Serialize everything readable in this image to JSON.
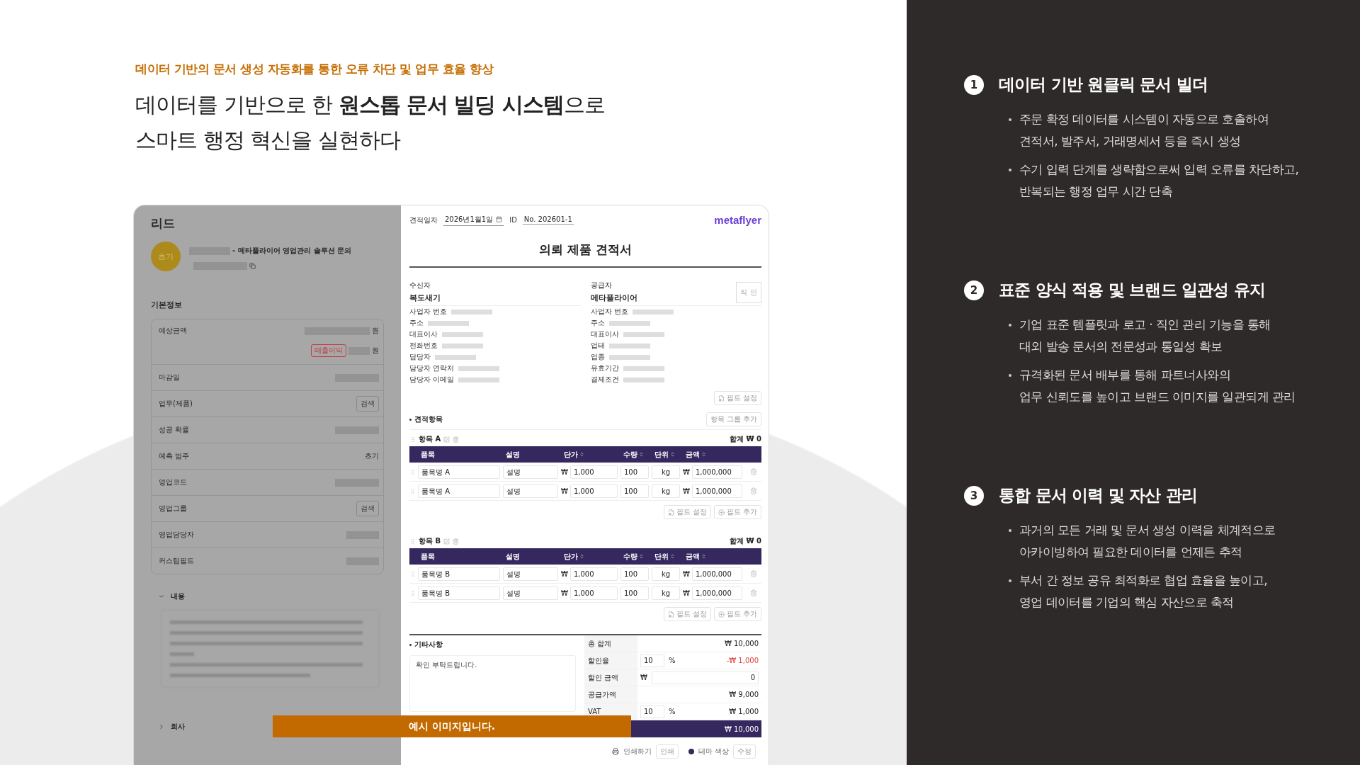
{
  "header": {
    "eyebrow": "데이터 기반의 문서 생성 자동화를 통한 오류 차단 및 업무 효율 향상",
    "headline": [
      "데이터를 기반으로 한 **원스톱 문서 빌딩 시스템**으로",
      "스마트 행정 혁신을 실현하다"
    ]
  },
  "lead_panel": {
    "title": "리드",
    "status_badge": "초기",
    "lead_name": "- 메타플라이어 영업관리 솔루션 문의",
    "section_title": "기본정보",
    "fields": [
      {
        "label": "예상금액",
        "kind": "amount",
        "unit": "원",
        "tag": "매출이익",
        "tag_unit": "원"
      },
      {
        "label": "마감일",
        "kind": "redacted"
      },
      {
        "label": "업무(제품)",
        "kind": "button",
        "button": "검색"
      },
      {
        "label": "성공 확률",
        "kind": "redacted"
      },
      {
        "label": "예측 범주",
        "kind": "text",
        "value": "초기"
      },
      {
        "label": "영업코드",
        "kind": "redacted"
      },
      {
        "label": "영업그룹",
        "kind": "button",
        "button": "검색"
      },
      {
        "label": "영업담당자",
        "kind": "redacted_short"
      },
      {
        "label": "커스텀필드",
        "kind": "redacted_short"
      }
    ],
    "sections": [
      {
        "title": "내용",
        "expanded": true
      },
      {
        "title": "회사",
        "expanded": false
      }
    ]
  },
  "quote": {
    "date_label": "견적일자",
    "date": "2026년1월1일",
    "id_label": "ID",
    "id_value": "No. 202601-1",
    "logo": "metaflyer",
    "title": "의뢰 제품 견적서",
    "parties": [
      {
        "role": "수신자",
        "name": "복도새기",
        "fields": [
          "사업자 번호",
          "주소",
          "대표이사",
          "전화번호",
          "담당자",
          "담당자 연락처",
          "담당자 이메일"
        ]
      },
      {
        "role": "공급자",
        "name": "메타플라이어",
        "stamp": "직 인",
        "fields": [
          "사업자 번호",
          "주소",
          "대표이사",
          "업태",
          "업종",
          "유효기간",
          "결제조건"
        ]
      }
    ],
    "field_settings_button": "필드 설정",
    "items_title": "견적항목",
    "add_group_button": "항목 그룹 추가",
    "groups": [
      {
        "name": "항목 A",
        "total_label": "합계",
        "total": "₩ 0",
        "columns": [
          {
            "label": "품목",
            "sortable": false
          },
          {
            "label": "설명",
            "sortable": false
          },
          {
            "label": "단가",
            "sortable": true
          },
          {
            "label": "수량",
            "sortable": true
          },
          {
            "label": "단위",
            "sortable": true
          },
          {
            "label": "금액",
            "sortable": true
          }
        ],
        "rows": [
          {
            "item": "품목명 A",
            "description": "설명",
            "price_currency": "₩",
            "unit_price": "1,000",
            "quantity": "100",
            "unit": "kg",
            "amount_currency": "₩",
            "amount": "1,000,000"
          },
          {
            "item": "품목명 A",
            "description": "설명",
            "price_currency": "₩",
            "unit_price": "1,000",
            "quantity": "100",
            "unit": "kg",
            "amount_currency": "₩",
            "amount": "1,000,000"
          }
        ],
        "buttons": [
          {
            "label": "필드 설정",
            "kind": "settings"
          },
          {
            "label": "필드 추가",
            "kind": "add"
          }
        ]
      },
      {
        "name": "항목 B",
        "total_label": "합계",
        "total": "₩ 0",
        "columns": [
          {
            "label": "품목",
            "sortable": false
          },
          {
            "label": "설명",
            "sortable": false
          },
          {
            "label": "단가",
            "sortable": true
          },
          {
            "label": "수량",
            "sortable": true
          },
          {
            "label": "단위",
            "sortable": true
          },
          {
            "label": "금액",
            "sortable": true
          }
        ],
        "rows": [
          {
            "item": "품목명 B",
            "description": "설명",
            "price_currency": "₩",
            "unit_price": "1,000",
            "quantity": "100",
            "unit": "kg",
            "amount_currency": "₩",
            "amount": "1,000,000"
          },
          {
            "item": "품목명 B",
            "description": "설명",
            "price_currency": "₩",
            "unit_price": "1,000",
            "quantity": "100",
            "unit": "kg",
            "amount_currency": "₩",
            "amount": "1,000,000"
          }
        ],
        "buttons": [
          {
            "label": "필드 설정",
            "kind": "settings"
          },
          {
            "label": "필드 추가",
            "kind": "add"
          }
        ]
      }
    ],
    "notes_title": "기타사항",
    "notes": "확인 부탁드립니다.",
    "totals": [
      {
        "label": "총 합계",
        "kind": "value",
        "value": "₩ 10,000",
        "negative": false
      },
      {
        "label": "할인율",
        "kind": "percent",
        "input": "10",
        "unit": "%",
        "value": "-₩ 1,000",
        "negative": true
      },
      {
        "label": "할인 금액",
        "kind": "input",
        "currency": "₩",
        "input": "0"
      },
      {
        "label": "공급가액",
        "kind": "value",
        "value": "₩ 9,000",
        "negative": false
      },
      {
        "label": "VAT",
        "kind": "percent",
        "input": "10",
        "unit": "%",
        "value": "₩ 1,000",
        "negative": false
      }
    ],
    "grand_total": "₩ 10,000",
    "actions": [
      {
        "label": "인쇄하기",
        "button": "인쇄",
        "kind": "print"
      },
      {
        "label": "테마 색상",
        "button": "수정",
        "kind": "theme"
      }
    ]
  },
  "banner": "예시 이미지입니다.",
  "features": [
    {
      "number": "1",
      "title": "데이터 기반 원클릭 문서 빌더",
      "bullets": [
        "주문 확정 데이터를 시스템이 자동으로 호출하여\n견적서, 발주서, 거래명세서 등을 즉시 생성",
        "수기 입력 단계를 생략함으로써 입력 오류를 차단하고,\n반복되는 행정 업무 시간 단축"
      ]
    },
    {
      "number": "2",
      "title": "표준 양식 적용 및 브랜드 일관성 유지",
      "bullets": [
        "기업 표준 템플릿과 로고 · 직인 관리 기능을 통해\n대외 발송 문서의 전문성과 통일성 확보",
        "규격화된 문서 배부를 통해 파트너사와의\n업무 신뢰도를 높이고 브랜드 이미지를 일관되게 관리"
      ]
    },
    {
      "number": "3",
      "title": "통합 문서 이력 및 자산 관리",
      "bullets": [
        "과거의 모든 거래 및 문서 생성 이력을 체계적으로\n아카이빙하여 필요한 데이터를 언제든 추적",
        "부서 간 정보 공유 최적화로 협업 효율을 높이고,\n영업 데이터를 기업의 핵심 자산으로 축적"
      ]
    }
  ]
}
